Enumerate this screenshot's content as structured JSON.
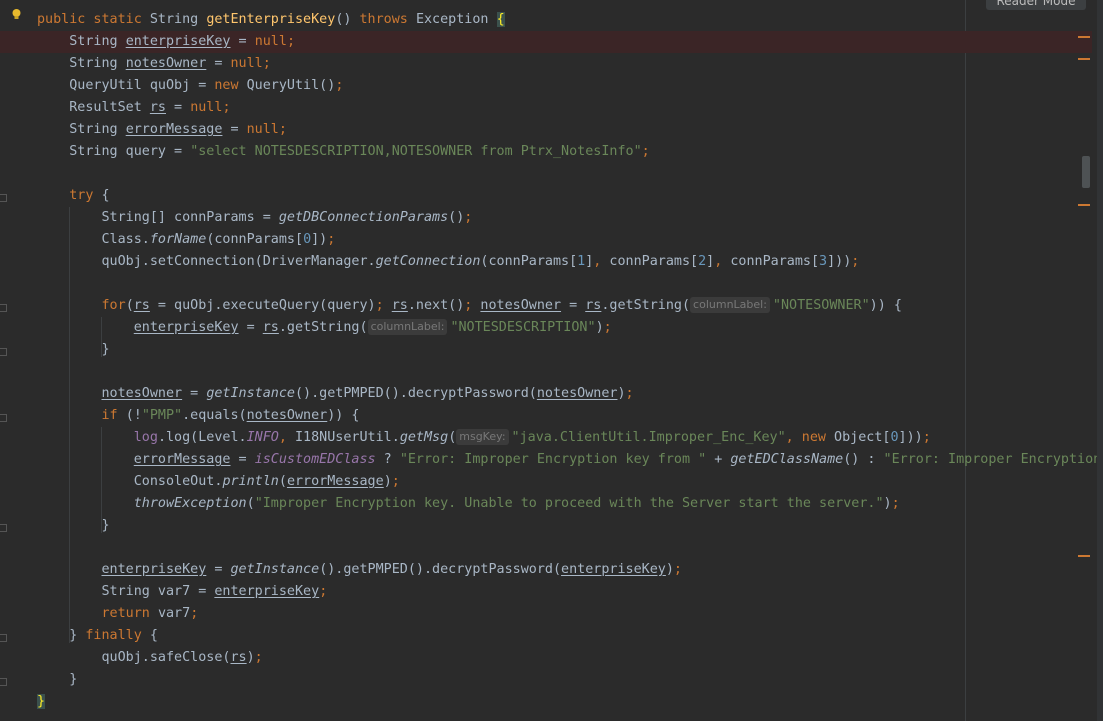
{
  "header": {
    "reader_mode_label": "Reader Mode"
  },
  "colors": {
    "background": "#2b2b2b",
    "keyword": "#cc7832",
    "method_declaration": "#ffc66d",
    "string": "#6a8759",
    "number": "#6897bb",
    "field": "#9876aa",
    "default_text": "#a9b7c6",
    "error_line_highlight": "#3b2526"
  },
  "code": {
    "lines": [
      [
        {
          "t": "public static ",
          "c": "kw"
        },
        {
          "t": "String "
        },
        {
          "t": "getEnterpriseKey",
          "c": "fn"
        },
        {
          "t": "() "
        },
        {
          "t": "throws ",
          "c": "kw"
        },
        {
          "t": "Exception "
        },
        {
          "t": "{",
          "c": "brace-hl"
        }
      ],
      [
        {
          "t": "    String "
        },
        {
          "t": "enterpriseKey",
          "c": "ul"
        },
        {
          "t": " = "
        },
        {
          "t": "null",
          "c": "kw"
        },
        {
          "t": ";",
          "c": "kw"
        }
      ],
      [
        {
          "t": "    String "
        },
        {
          "t": "notesOwner",
          "c": "ul"
        },
        {
          "t": " = "
        },
        {
          "t": "null",
          "c": "kw"
        },
        {
          "t": ";",
          "c": "kw"
        }
      ],
      [
        {
          "t": "    QueryUtil quObj = "
        },
        {
          "t": "new ",
          "c": "kw"
        },
        {
          "t": "QueryUtil()"
        },
        {
          "t": ";",
          "c": "kw"
        }
      ],
      [
        {
          "t": "    ResultSet "
        },
        {
          "t": "rs",
          "c": "ul"
        },
        {
          "t": " = "
        },
        {
          "t": "null",
          "c": "kw"
        },
        {
          "t": ";",
          "c": "kw"
        }
      ],
      [
        {
          "t": "    String "
        },
        {
          "t": "errorMessage",
          "c": "ul"
        },
        {
          "t": " = "
        },
        {
          "t": "null",
          "c": "kw"
        },
        {
          "t": ";",
          "c": "kw"
        }
      ],
      [
        {
          "t": "    String query = "
        },
        {
          "t": "\"select NOTESDESCRIPTION,NOTESOWNER from Ptrx_NotesInfo\"",
          "c": "str"
        },
        {
          "t": ";",
          "c": "kw"
        }
      ],
      [],
      [
        {
          "t": "    "
        },
        {
          "t": "try ",
          "c": "kw"
        },
        {
          "t": "{"
        }
      ],
      [
        {
          "t": "        String[] connParams = "
        },
        {
          "t": "getDBConnectionParams",
          "c": "st"
        },
        {
          "t": "()"
        },
        {
          "t": ";",
          "c": "kw"
        }
      ],
      [
        {
          "t": "        Class."
        },
        {
          "t": "forName",
          "c": "st"
        },
        {
          "t": "(connParams["
        },
        {
          "t": "0",
          "c": "num"
        },
        {
          "t": "])"
        },
        {
          "t": ";",
          "c": "kw"
        }
      ],
      [
        {
          "t": "        quObj.setConnection(DriverManager."
        },
        {
          "t": "getConnection",
          "c": "st"
        },
        {
          "t": "(connParams["
        },
        {
          "t": "1",
          "c": "num"
        },
        {
          "t": "]"
        },
        {
          "t": ", ",
          "c": "kw"
        },
        {
          "t": "connParams["
        },
        {
          "t": "2",
          "c": "num"
        },
        {
          "t": "]"
        },
        {
          "t": ", ",
          "c": "kw"
        },
        {
          "t": "connParams["
        },
        {
          "t": "3",
          "c": "num"
        },
        {
          "t": "]))"
        },
        {
          "t": ";",
          "c": "kw"
        }
      ],
      [],
      [
        {
          "t": "        "
        },
        {
          "t": "for",
          "c": "kw"
        },
        {
          "t": "("
        },
        {
          "t": "rs",
          "c": "ul"
        },
        {
          "t": " = quObj.executeQuery(query)"
        },
        {
          "t": "; ",
          "c": "kw"
        },
        {
          "t": "rs",
          "c": "ul"
        },
        {
          "t": ".next()"
        },
        {
          "t": "; ",
          "c": "kw"
        },
        {
          "t": "notesOwner",
          "c": "ul"
        },
        {
          "t": " = "
        },
        {
          "t": "rs",
          "c": "ul"
        },
        {
          "t": ".getString("
        },
        {
          "t": "columnLabel:",
          "c": "hint"
        },
        {
          "t": "\"NOTESOWNER\"",
          "c": "str"
        },
        {
          "t": ")) {"
        }
      ],
      [
        {
          "t": "            "
        },
        {
          "t": "enterpriseKey",
          "c": "ul"
        },
        {
          "t": " = "
        },
        {
          "t": "rs",
          "c": "ul"
        },
        {
          "t": ".getString("
        },
        {
          "t": "columnLabel:",
          "c": "hint"
        },
        {
          "t": "\"NOTESDESCRIPTION\"",
          "c": "str"
        },
        {
          "t": ")"
        },
        {
          "t": ";",
          "c": "kw"
        }
      ],
      [
        {
          "t": "        }"
        }
      ],
      [],
      [
        {
          "t": "        "
        },
        {
          "t": "notesOwner",
          "c": "ul"
        },
        {
          "t": " = "
        },
        {
          "t": "getInstance",
          "c": "st"
        },
        {
          "t": "().getPMPED().decryptPassword("
        },
        {
          "t": "notesOwner",
          "c": "ul"
        },
        {
          "t": ")"
        },
        {
          "t": ";",
          "c": "kw"
        }
      ],
      [
        {
          "t": "        "
        },
        {
          "t": "if ",
          "c": "kw"
        },
        {
          "t": "(!"
        },
        {
          "t": "\"PMP\"",
          "c": "str"
        },
        {
          "t": ".equals("
        },
        {
          "t": "notesOwner",
          "c": "ul"
        },
        {
          "t": ")) {"
        }
      ],
      [
        {
          "t": "            "
        },
        {
          "t": "log",
          "c": "fld"
        },
        {
          "t": ".log(Level."
        },
        {
          "t": "INFO",
          "c": "fld st"
        },
        {
          "t": ", ",
          "c": "kw"
        },
        {
          "t": "I18NUserUtil."
        },
        {
          "t": "getMsg",
          "c": "st"
        },
        {
          "t": "("
        },
        {
          "t": "msgKey:",
          "c": "hint"
        },
        {
          "t": "\"java.ClientUtil.Improper_Enc_Key\"",
          "c": "str"
        },
        {
          "t": ", ",
          "c": "kw"
        },
        {
          "t": "new ",
          "c": "kw"
        },
        {
          "t": "Object["
        },
        {
          "t": "0",
          "c": "num"
        },
        {
          "t": "]))"
        },
        {
          "t": ";",
          "c": "kw"
        }
      ],
      [
        {
          "t": "            "
        },
        {
          "t": "errorMessage",
          "c": "ul"
        },
        {
          "t": " = "
        },
        {
          "t": "isCustomEDClass",
          "c": "fld st"
        },
        {
          "t": " ? "
        },
        {
          "t": "\"Error: Improper Encryption key from \"",
          "c": "str"
        },
        {
          "t": " + "
        },
        {
          "t": "getEDClassName",
          "c": "st"
        },
        {
          "t": "() : "
        },
        {
          "t": "\"Error: Improper Encryption",
          "c": "str"
        }
      ],
      [
        {
          "t": "            ConsoleOut."
        },
        {
          "t": "println",
          "c": "st"
        },
        {
          "t": "("
        },
        {
          "t": "errorMessage",
          "c": "ul"
        },
        {
          "t": ")"
        },
        {
          "t": ";",
          "c": "kw"
        }
      ],
      [
        {
          "t": "            "
        },
        {
          "t": "throwException",
          "c": "st"
        },
        {
          "t": "("
        },
        {
          "t": "\"Improper Encryption key. Unable to proceed with the Server start the server.\"",
          "c": "str"
        },
        {
          "t": ")"
        },
        {
          "t": ";",
          "c": "kw"
        }
      ],
      [
        {
          "t": "        }"
        }
      ],
      [],
      [
        {
          "t": "        "
        },
        {
          "t": "enterpriseKey",
          "c": "ul"
        },
        {
          "t": " = "
        },
        {
          "t": "getInstance",
          "c": "st"
        },
        {
          "t": "().getPMPED().decryptPassword("
        },
        {
          "t": "enterpriseKey",
          "c": "ul"
        },
        {
          "t": ")"
        },
        {
          "t": ";",
          "c": "kw"
        }
      ],
      [
        {
          "t": "        String var7 = "
        },
        {
          "t": "enterpriseKey",
          "c": "ul"
        },
        {
          "t": ";",
          "c": "kw"
        }
      ],
      [
        {
          "t": "        "
        },
        {
          "t": "return ",
          "c": "kw"
        },
        {
          "t": "var7"
        },
        {
          "t": ";",
          "c": "kw"
        }
      ],
      [
        {
          "t": "    } "
        },
        {
          "t": "finally ",
          "c": "kw"
        },
        {
          "t": "{"
        }
      ],
      [
        {
          "t": "        quObj.safeClose("
        },
        {
          "t": "rs",
          "c": "ul"
        },
        {
          "t": ")"
        },
        {
          "t": ";",
          "c": "kw"
        }
      ],
      [
        {
          "t": "    }"
        }
      ],
      [
        {
          "t": "}",
          "c": "brace-hl"
        }
      ]
    ]
  }
}
